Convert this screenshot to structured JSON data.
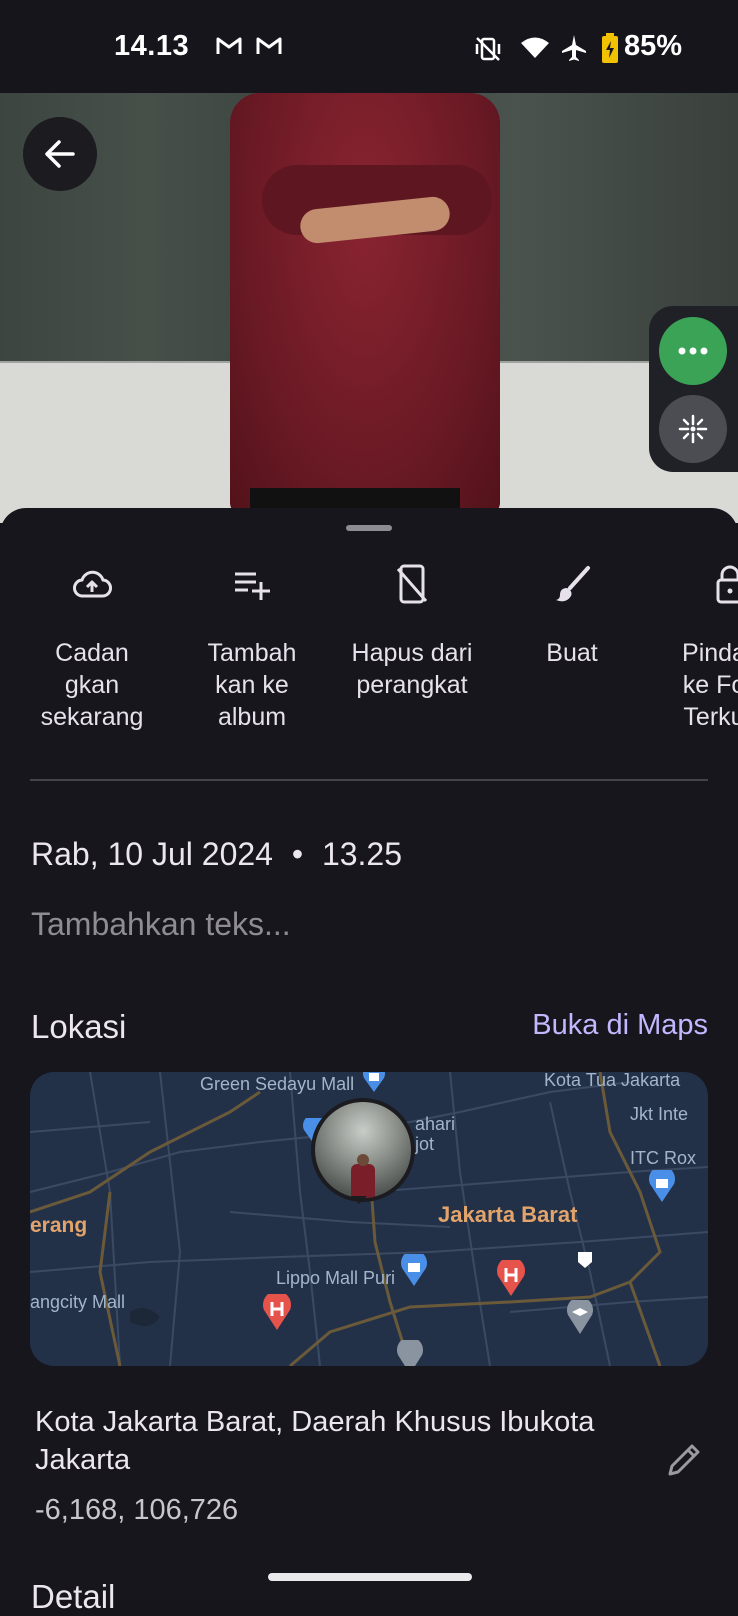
{
  "status_bar": {
    "time": "14.13",
    "battery": "85%"
  },
  "actions": [
    {
      "label": "Cadan gkan sekarang",
      "icon": "cloud-upload-icon"
    },
    {
      "label": "Tambah kan ke album",
      "icon": "playlist-add-icon"
    },
    {
      "label": "Hapus dari perangkat",
      "icon": "phone-off-icon"
    },
    {
      "label": "Buat",
      "icon": "brush-icon"
    },
    {
      "label": "Pinda ke Fo Terku",
      "icon": "lock-icon"
    }
  ],
  "info": {
    "date": "Rab, 10 Jul 2024",
    "time": "13.25",
    "separator": "•",
    "add_text_placeholder": "Tambahkan teks..."
  },
  "location": {
    "title": "Lokasi",
    "open_maps": "Buka di Maps",
    "address": "Kota Jakarta Barat, Daerah Khusus Ibukota Jakarta",
    "coordinates": "-6,168, 106,726",
    "map_labels": {
      "green_sedayu": "Green Sedayu Mall",
      "kota_tua": "Kota Tua Jakarta",
      "jkt_inter": "Jkt Inte",
      "itc": "ITC Rox",
      "matahari": "ahari",
      "matahari2": "jot",
      "district": "Jakarta Barat",
      "tangerang": "erang",
      "lippo": "Lippo Mall Puri",
      "tangcity": "angcity Mall"
    }
  },
  "detail_title": "Detail",
  "colors": {
    "background": "#16161c",
    "accent_link": "#c3b8ff",
    "more_button": "#3ba356"
  }
}
